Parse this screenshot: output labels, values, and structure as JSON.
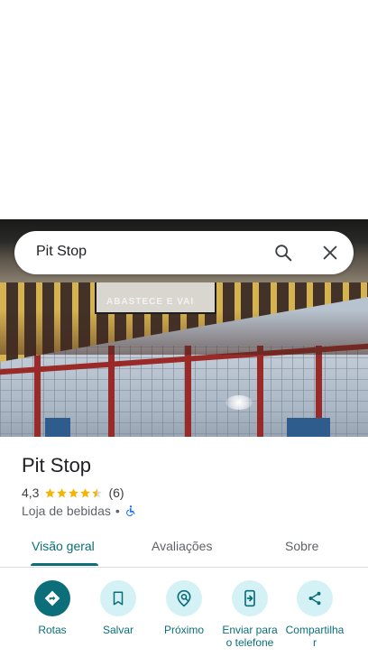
{
  "search": {
    "query": "Pit Stop"
  },
  "hero": {
    "sign_text": "ABASTECE E VAI"
  },
  "place": {
    "name": "Pit Stop",
    "rating": "4,3",
    "rating_value": 4.3,
    "review_count": "(6)",
    "category": "Loja de bebidas",
    "separator": "•"
  },
  "tabs": [
    {
      "label": "Visão geral",
      "active": true
    },
    {
      "label": "Avaliações",
      "active": false
    },
    {
      "label": "Sobre",
      "active": false
    }
  ],
  "actions": [
    {
      "label": "Rotas",
      "icon": "directions-icon"
    },
    {
      "label": "Salvar",
      "icon": "bookmark-icon"
    },
    {
      "label": "Próximo",
      "icon": "nearby-icon"
    },
    {
      "label": "Enviar para o telefone",
      "icon": "send-to-phone-icon"
    },
    {
      "label": "Compartilhar",
      "icon": "share-icon"
    }
  ],
  "colors": {
    "accent": "#0b6e79",
    "accent_light": "#d4f1f5",
    "star": "#f4b400",
    "accessibility": "#1a73e8"
  }
}
